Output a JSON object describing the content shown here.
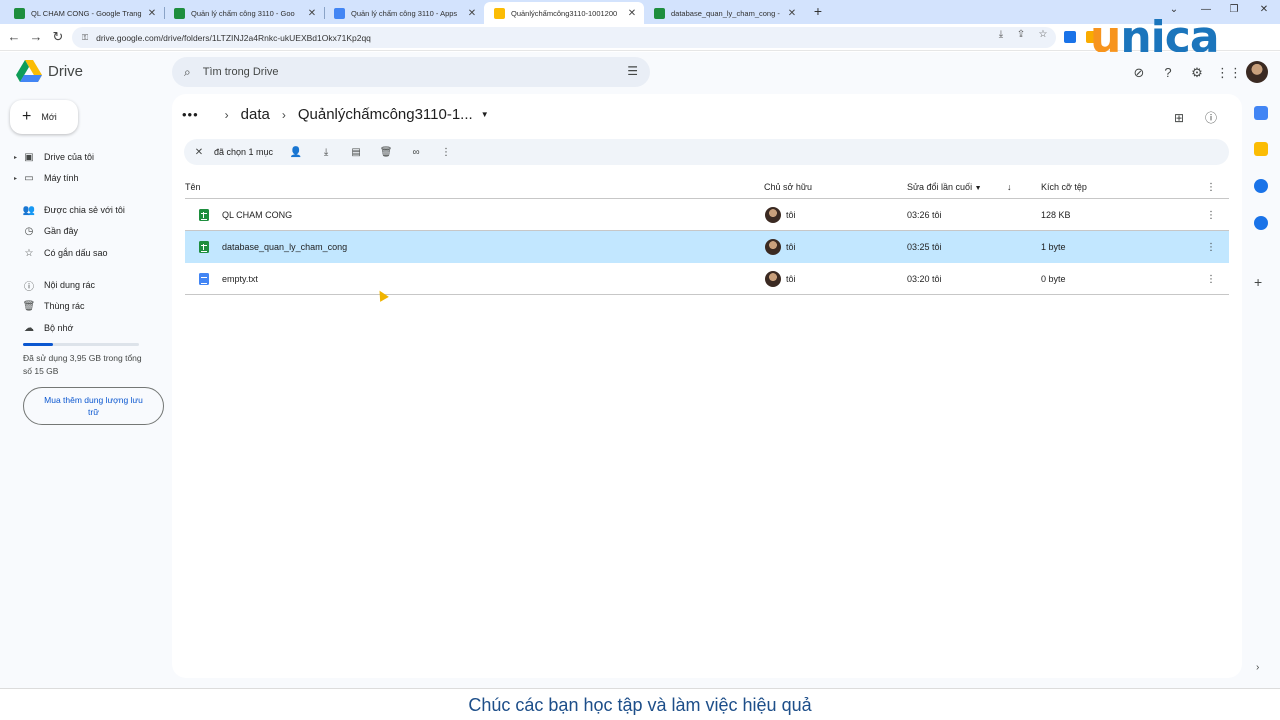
{
  "browser": {
    "tabs": [
      {
        "title": "QL CHAM CONG - Google Trang",
        "favicon_color": "#1e8e3e"
      },
      {
        "title": "Quản lý chấm công 3110 - Goo",
        "favicon_color": "#1e8e3e"
      },
      {
        "title": "Quản lý chấm công 3110 - Apps",
        "favicon_color": "#4285f4"
      },
      {
        "title": "Quảnlýchấmcông3110-1001200",
        "favicon_color": "#fbbc04"
      },
      {
        "title": "database_quan_ly_cham_cong -",
        "favicon_color": "#1e8e3e"
      }
    ],
    "active_tab_index": 3,
    "new_tab": "+",
    "window_controls": {
      "minimize": "—",
      "restore": "❐",
      "close": "✕",
      "menu": "⌄"
    },
    "url": "drive.google.com/drive/folders/1LTZINJ2a4Rnkc-ukUEXBd1Okx71Kp2qq",
    "nav": {
      "back": "←",
      "forward": "→",
      "reload": "↻"
    }
  },
  "watermark": {
    "first": "u",
    "rest": "nica"
  },
  "drive": {
    "logo_text": "Drive",
    "search_placeholder": "Tìm trong Drive",
    "new_button": "Mới",
    "sidebar": [
      {
        "label": "Drive của tôi",
        "icon": "my-drive-icon",
        "glyph": "▣",
        "caret": true
      },
      {
        "label": "Máy tính",
        "icon": "computer-icon",
        "glyph": "▭",
        "caret": true
      },
      {
        "label": "Được chia sẻ với tôi",
        "icon": "shared-icon",
        "glyph": "👥",
        "caret": false
      },
      {
        "label": "Gần đây",
        "icon": "clock-icon",
        "glyph": "◷",
        "caret": false
      },
      {
        "label": "Có gắn dấu sao",
        "icon": "star-icon",
        "glyph": "☆",
        "caret": false
      },
      {
        "label": "Nội dung rác",
        "icon": "spam-icon",
        "glyph": "ⓘ",
        "caret": false
      },
      {
        "label": "Thùng rác",
        "icon": "trash-icon",
        "glyph": "🗑",
        "caret": false
      },
      {
        "label": "Bộ nhớ",
        "icon": "cloud-icon",
        "glyph": "☁",
        "caret": false
      }
    ],
    "storage": {
      "used_fraction": 0.26,
      "text": "Đã sử dụng 3,95 GB trong tổng số 15 GB",
      "buy_button": "Mua thêm dung lượng lưu trữ"
    },
    "breadcrumb": {
      "more": "•••",
      "parent": "data",
      "current": "Quảnlýchấmcông3110-1...",
      "sep": "›",
      "dropdown": "▼"
    },
    "selection": {
      "count_label": "đã chọn 1 mục"
    },
    "columns": {
      "name": "Tên",
      "owner": "Chủ sở hữu",
      "modified": "Sửa đổi lần cuối",
      "size": "Kích cỡ tệp"
    },
    "files": [
      {
        "name": "QL CHAM CONG",
        "type": "sheet",
        "owner": "tôi",
        "modified": "03:26 tôi",
        "size": "128 KB",
        "selected": false
      },
      {
        "name": "database_quan_ly_cham_cong",
        "type": "sheet",
        "owner": "tôi",
        "modified": "03:25 tôi",
        "size": "1 byte",
        "selected": true
      },
      {
        "name": "empty.txt",
        "type": "doc",
        "owner": "tôi",
        "modified": "03:20 tôi",
        "size": "0 byte",
        "selected": false
      }
    ]
  },
  "caption": "Chúc các bạn học tập và làm việc hiệu quả"
}
